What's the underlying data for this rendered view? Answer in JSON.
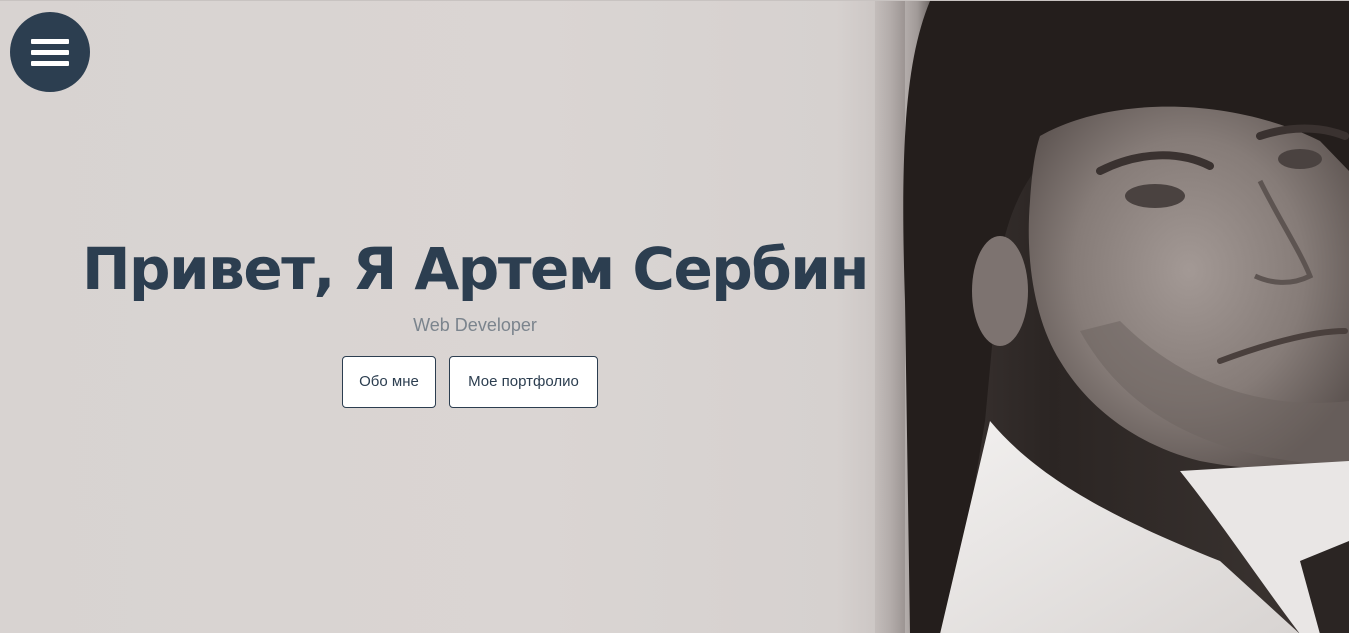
{
  "menu": {
    "icon": "hamburger-menu-icon",
    "background_color": "#2c3e50"
  },
  "hero": {
    "title": "Привет, Я Артем Сербин",
    "subtitle": "Web Developer",
    "title_color": "#2c3e50",
    "subtitle_color": "#7b848d",
    "buttons": [
      {
        "label": "Обо мне"
      },
      {
        "label": "Мое портфолио"
      }
    ],
    "background_image": "portrait-photo"
  }
}
